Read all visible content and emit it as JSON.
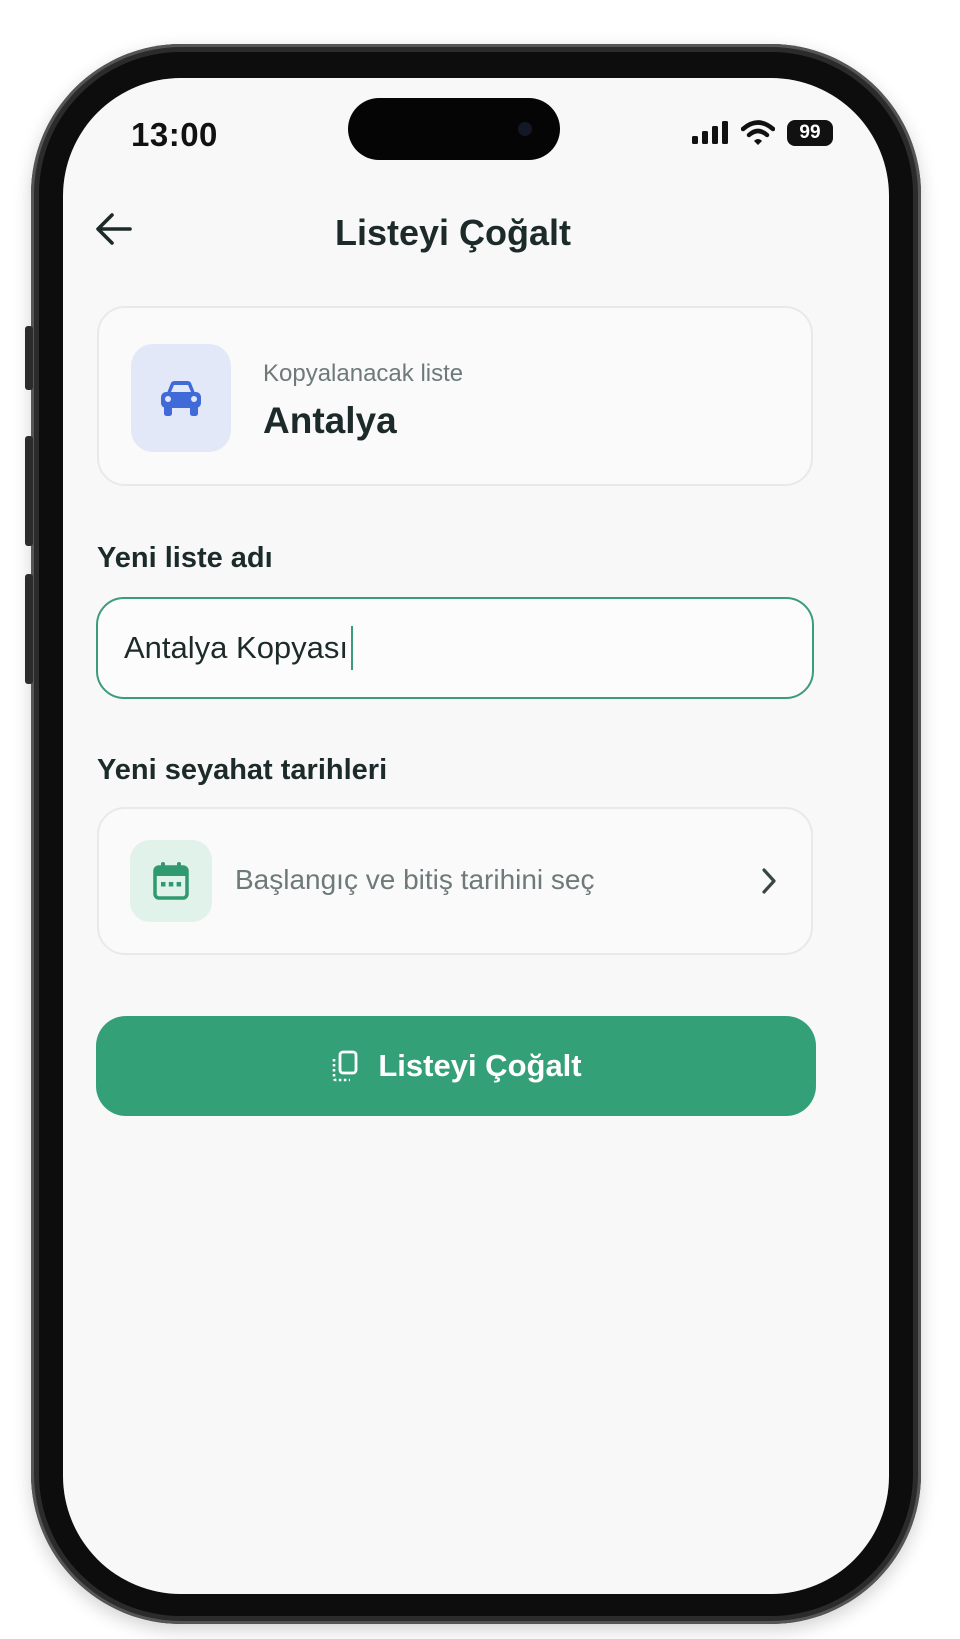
{
  "status_bar": {
    "time": "13:00",
    "battery": "99"
  },
  "header": {
    "title": "Listeyi Çoğalt"
  },
  "source_list": {
    "label": "Kopyalanacak liste",
    "name": "Antalya",
    "icon": "car-icon",
    "icon_color": "#3f6ad8",
    "icon_bg": "#e3e8f8"
  },
  "new_name": {
    "label": "Yeni liste adı",
    "value": "Antalya Kopyası"
  },
  "dates": {
    "label": "Yeni seyahat tarihleri",
    "placeholder": "Başlangıç ve bitiş tarihini seç",
    "icon": "calendar-icon",
    "icon_color": "#2f9a70"
  },
  "action": {
    "label": "Listeyi Çoğalt",
    "icon": "duplicate-icon",
    "color": "#34a078"
  }
}
